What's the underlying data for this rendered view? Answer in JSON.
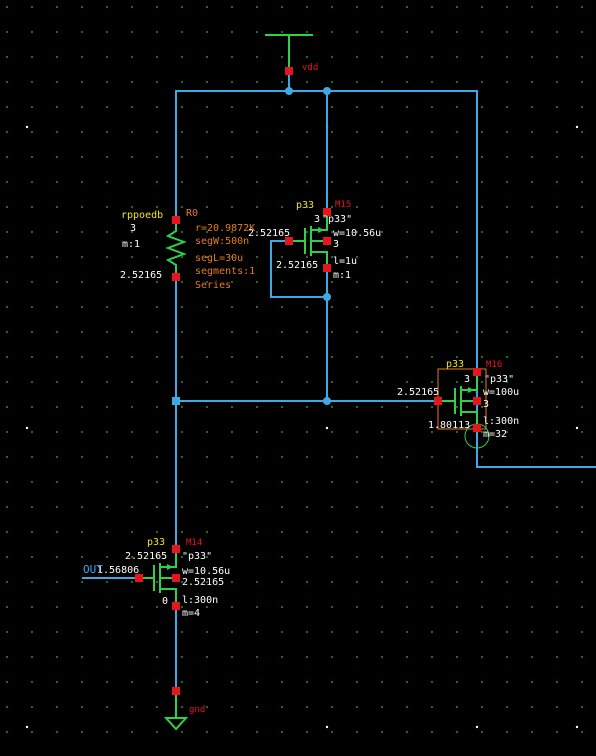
{
  "nets": {
    "vdd": "vdd",
    "gnd": "gnd",
    "out": "OUT"
  },
  "r0": {
    "model": "rppoedb",
    "name": "R0",
    "term": "3",
    "m": "m:1",
    "r": "r=20.9872K",
    "segW": "segW:500n",
    "segL": "segL=30u",
    "segments": "segments:1",
    "series": "Series",
    "voltage": "2.52165"
  },
  "m15": {
    "model": "p33",
    "name": "M15",
    "term": "3",
    "model_q": "\"p33\"",
    "w": "w=10.56u",
    "l": "l=1u",
    "m": "m:1",
    "gate_v": "2.52165",
    "drain_v": "2.52165",
    "bulk": "3"
  },
  "m16": {
    "model": "p33",
    "name": "M16",
    "term": "3",
    "model_q": "\"p33\"",
    "w": "w=100u",
    "l": "l:300n",
    "m": "m=32",
    "gate_v": "2.52165",
    "drain_v": "1.80113",
    "bulk": "3"
  },
  "m14": {
    "model": "p33",
    "name": "M14",
    "model_q": "\"p33\"",
    "w": "w=10.56u",
    "l": "l:300n",
    "m": "m=4",
    "source_v": "2.52165",
    "gate_v": "1.56806",
    "bulk_v": "2.52165",
    "drain": "0"
  },
  "colors": {
    "background": "#000000",
    "wire": "#3fa9e6",
    "device": "#2fd04a",
    "pin": "#e8141c",
    "instance_label": "#f2e41a",
    "params": "#e87c1a",
    "voltage": "#ffffff"
  }
}
